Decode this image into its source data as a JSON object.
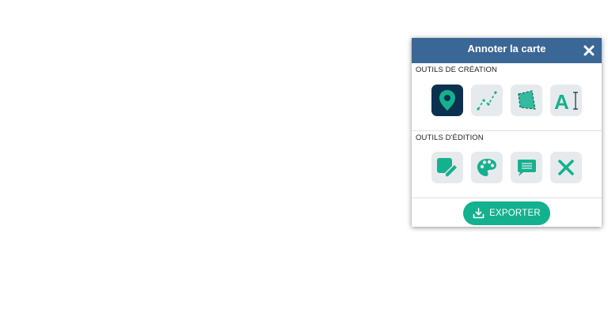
{
  "panel": {
    "title": "Annoter la carte",
    "close_icon": "close-icon"
  },
  "creation": {
    "label": "OUTILS DE CRÉATION",
    "tools": [
      {
        "icon": "map-marker-icon",
        "active": true
      },
      {
        "icon": "polyline-icon",
        "active": false
      },
      {
        "icon": "polygon-icon",
        "active": false
      },
      {
        "icon": "text-tool-icon",
        "active": false
      }
    ]
  },
  "edition": {
    "label": "OUTILS D'ÉDITION",
    "tools": [
      {
        "icon": "edit-shape-icon"
      },
      {
        "icon": "palette-icon"
      },
      {
        "icon": "comment-icon"
      },
      {
        "icon": "delete-icon"
      }
    ]
  },
  "export": {
    "label": "EXPORTER",
    "icon": "download-icon"
  },
  "colors": {
    "header": "#3b6797",
    "accent": "#14b18f",
    "active_tool": "#0b3050",
    "tool_bg": "#e7eaed"
  }
}
